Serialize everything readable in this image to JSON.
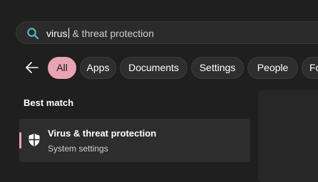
{
  "search": {
    "typed": "virus",
    "suggestion": " & threat protection"
  },
  "filters": {
    "items": [
      {
        "label": "All",
        "active": true
      },
      {
        "label": "Apps"
      },
      {
        "label": "Documents"
      },
      {
        "label": "Settings"
      },
      {
        "label": "People"
      },
      {
        "label": "Fo"
      }
    ]
  },
  "results": {
    "section_title": "Best match",
    "best_match": {
      "title": "Virus & threat protection",
      "subtitle": "System settings",
      "icon": "shield-icon"
    }
  },
  "colors": {
    "accent": "#e8a4b3",
    "background": "#1f1f1f",
    "search_icon": "#4fc3c8"
  }
}
